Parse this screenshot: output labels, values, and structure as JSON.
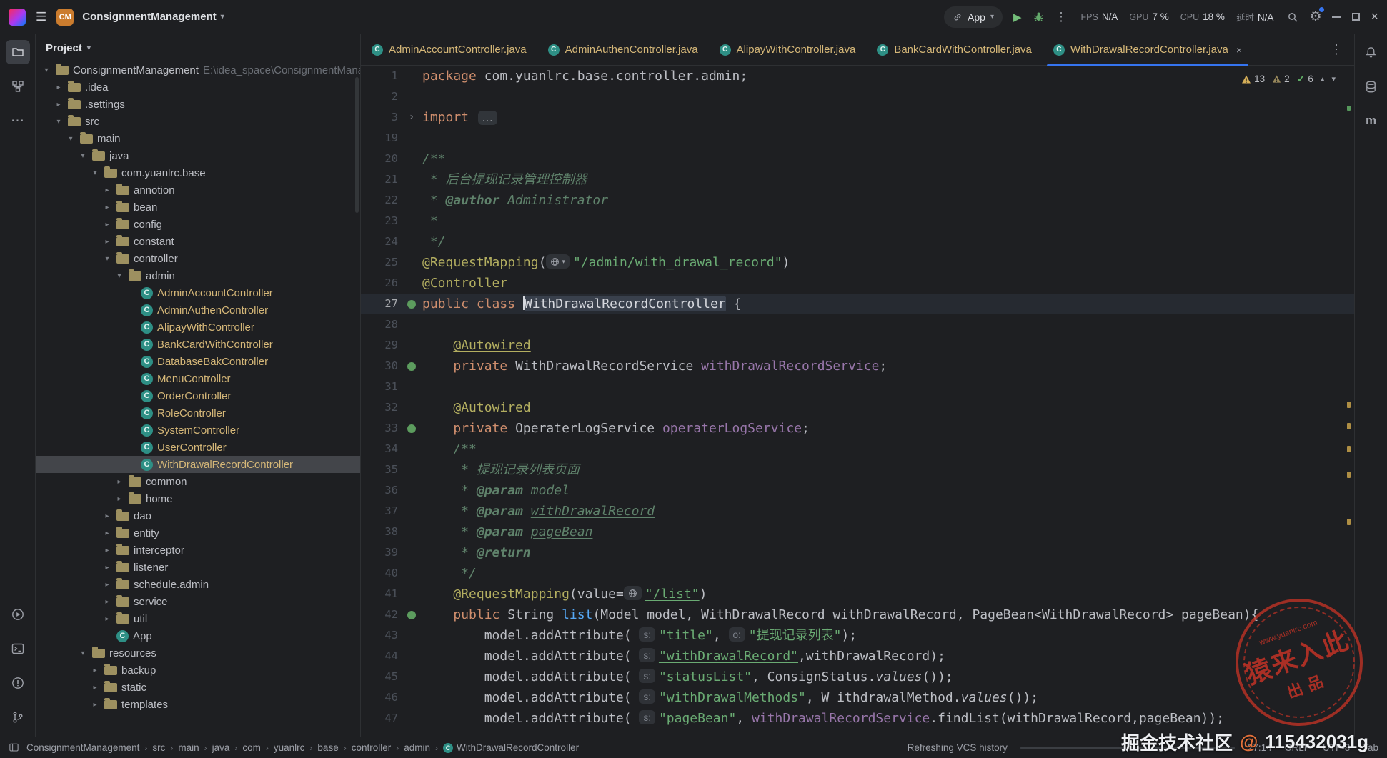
{
  "titlebar": {
    "project_name": "ConsignmentManagement",
    "badge": "CM",
    "run_config": "App",
    "stats": [
      {
        "label": "FPS",
        "value": "N/A"
      },
      {
        "label": "GPU",
        "value": "7 %"
      },
      {
        "label": "CPU",
        "value": "18 %"
      },
      {
        "label": "延时",
        "value": "N/A"
      }
    ]
  },
  "icons": {
    "hamburger-icon": "☰",
    "chevron-down-icon": "▾",
    "chevron-right-icon": "▸",
    "more-vertical-icon": "⋮",
    "more-horizontal-icon": "⋯",
    "run-icon": "▶",
    "close-icon": "×",
    "settings-gear-icon": "⚙",
    "check-icon": "✓",
    "maven-icon": "m",
    "prev-icon": "▴",
    "next-icon": "▾"
  },
  "project_tree": {
    "header": "Project",
    "items": [
      {
        "l": "ConsignmentManagement",
        "lv": 0,
        "ch": "o",
        "ic": "folder",
        "suffix": " E:\\idea_space\\ConsignmentManagemen"
      },
      {
        "l": ".idea",
        "lv": 1,
        "ch": "c",
        "ic": "folder"
      },
      {
        "l": ".settings",
        "lv": 1,
        "ch": "c",
        "ic": "folder"
      },
      {
        "l": "src",
        "lv": 1,
        "ch": "o",
        "ic": "folder"
      },
      {
        "l": "main",
        "lv": 2,
        "ch": "o",
        "ic": "folder"
      },
      {
        "l": "java",
        "lv": 3,
        "ch": "o",
        "ic": "folder"
      },
      {
        "l": "com.yuanlrc.base",
        "lv": 4,
        "ch": "o",
        "ic": "folder"
      },
      {
        "l": "annotion",
        "lv": 5,
        "ch": "c",
        "ic": "folder"
      },
      {
        "l": "bean",
        "lv": 5,
        "ch": "c",
        "ic": "folder"
      },
      {
        "l": "config",
        "lv": 5,
        "ch": "c",
        "ic": "folder"
      },
      {
        "l": "constant",
        "lv": 5,
        "ch": "c",
        "ic": "folder"
      },
      {
        "l": "controller",
        "lv": 5,
        "ch": "o",
        "ic": "folder"
      },
      {
        "l": "admin",
        "lv": 6,
        "ch": "o",
        "ic": "folder"
      },
      {
        "l": "AdminAccountController",
        "lv": 7,
        "ic": "class",
        "amber": true
      },
      {
        "l": "AdminAuthenController",
        "lv": 7,
        "ic": "class",
        "amber": true
      },
      {
        "l": "AlipayWithController",
        "lv": 7,
        "ic": "class",
        "amber": true
      },
      {
        "l": "BankCardWithController",
        "lv": 7,
        "ic": "class",
        "amber": true
      },
      {
        "l": "DatabaseBakController",
        "lv": 7,
        "ic": "class",
        "amber": true
      },
      {
        "l": "MenuController",
        "lv": 7,
        "ic": "class",
        "amber": true
      },
      {
        "l": "OrderController",
        "lv": 7,
        "ic": "class",
        "amber": true
      },
      {
        "l": "RoleController",
        "lv": 7,
        "ic": "class",
        "amber": true
      },
      {
        "l": "SystemController",
        "lv": 7,
        "ic": "class",
        "amber": true
      },
      {
        "l": "UserController",
        "lv": 7,
        "ic": "class",
        "amber": true
      },
      {
        "l": "WithDrawalRecordController",
        "lv": 7,
        "ic": "class",
        "amber": true,
        "sel": true
      },
      {
        "l": "common",
        "lv": 6,
        "ch": "c",
        "ic": "folder"
      },
      {
        "l": "home",
        "lv": 6,
        "ch": "c",
        "ic": "folder"
      },
      {
        "l": "dao",
        "lv": 5,
        "ch": "c",
        "ic": "folder"
      },
      {
        "l": "entity",
        "lv": 5,
        "ch": "c",
        "ic": "folder"
      },
      {
        "l": "interceptor",
        "lv": 5,
        "ch": "c",
        "ic": "folder"
      },
      {
        "l": "listener",
        "lv": 5,
        "ch": "c",
        "ic": "folder"
      },
      {
        "l": "schedule.admin",
        "lv": 5,
        "ch": "c",
        "ic": "folder"
      },
      {
        "l": "service",
        "lv": 5,
        "ch": "c",
        "ic": "folder"
      },
      {
        "l": "util",
        "lv": 5,
        "ch": "c",
        "ic": "folder"
      },
      {
        "l": "App",
        "lv": 5,
        "ic": "class"
      },
      {
        "l": "resources",
        "lv": 3,
        "ch": "o",
        "ic": "folder"
      },
      {
        "l": "backup",
        "lv": 4,
        "ch": "c",
        "ic": "folder"
      },
      {
        "l": "static",
        "lv": 4,
        "ch": "c",
        "ic": "folder"
      },
      {
        "l": "templates",
        "lv": 4,
        "ch": "c",
        "ic": "folder"
      }
    ]
  },
  "tabs": [
    {
      "label": "AdminAccountController.java"
    },
    {
      "label": "AdminAuthenController.java"
    },
    {
      "label": "AlipayWithController.java"
    },
    {
      "label": "BankCardWithController.java"
    },
    {
      "label": "WithDrawalRecordController.java",
      "active": true
    }
  ],
  "editor": {
    "inspections": {
      "warnings": "13",
      "weak_warnings": "2",
      "passed": "6"
    },
    "lines": [
      {
        "n": 1,
        "tk": [
          {
            "c": "k",
            "t": "package "
          },
          {
            "c": "d",
            "t": "com.yuanlrc.base.controller.admin;"
          }
        ]
      },
      {
        "n": 2,
        "tk": []
      },
      {
        "n": 3,
        "g": "fold",
        "tk": [
          {
            "c": "k",
            "t": "import "
          },
          {
            "c": "fold",
            "t": "..."
          }
        ]
      },
      {
        "n": 19,
        "tk": []
      },
      {
        "n": 20,
        "tk": [
          {
            "c": "c",
            "t": "/**"
          }
        ]
      },
      {
        "n": 21,
        "tk": [
          {
            "c": "c",
            "t": " * 后台提现记录管理控制器"
          }
        ]
      },
      {
        "n": 22,
        "tk": [
          {
            "c": "c",
            "t": " * "
          },
          {
            "c": "ct",
            "t": "@author"
          },
          {
            "c": "c",
            "t": " Administrator"
          }
        ]
      },
      {
        "n": 23,
        "tk": [
          {
            "c": "c",
            "t": " *"
          }
        ]
      },
      {
        "n": 24,
        "tk": [
          {
            "c": "c",
            "t": " */"
          }
        ]
      },
      {
        "n": 25,
        "tk": [
          {
            "c": "a",
            "t": "@RequestMapping"
          },
          {
            "c": "d",
            "t": "("
          },
          {
            "c": "globe",
            "dd": true
          },
          {
            "c": "su",
            "t": "\"/admin/with_drawal_record\""
          },
          {
            "c": "d",
            "t": ")"
          }
        ]
      },
      {
        "n": 26,
        "tk": [
          {
            "c": "a",
            "t": "@Controller"
          }
        ]
      },
      {
        "n": 27,
        "active": true,
        "g": "spring",
        "tk": [
          {
            "c": "k",
            "t": "public class "
          },
          {
            "c": "caret"
          },
          {
            "c": "dh",
            "t": "WithDrawalRecordController"
          },
          {
            "c": "d",
            "t": " {"
          }
        ]
      },
      {
        "n": 28,
        "tk": []
      },
      {
        "n": 29,
        "tk": [
          {
            "c": "d",
            "t": "    "
          },
          {
            "c": "au",
            "t": "@Autowired"
          }
        ]
      },
      {
        "n": 30,
        "g": "spring",
        "tk": [
          {
            "c": "d",
            "t": "    "
          },
          {
            "c": "k",
            "t": "private "
          },
          {
            "c": "d",
            "t": "WithDrawalRecordService "
          },
          {
            "c": "f",
            "t": "withDrawalRecordService"
          },
          {
            "c": "d",
            "t": ";"
          }
        ]
      },
      {
        "n": 31,
        "tk": []
      },
      {
        "n": 32,
        "tk": [
          {
            "c": "d",
            "t": "    "
          },
          {
            "c": "au",
            "t": "@Autowired"
          }
        ]
      },
      {
        "n": 33,
        "g": "spring",
        "tk": [
          {
            "c": "d",
            "t": "    "
          },
          {
            "c": "k",
            "t": "private "
          },
          {
            "c": "d",
            "t": "OperaterLogService "
          },
          {
            "c": "f",
            "t": "operaterLogService"
          },
          {
            "c": "d",
            "t": ";"
          }
        ]
      },
      {
        "n": 34,
        "tk": [
          {
            "c": "d",
            "t": "    "
          },
          {
            "c": "c",
            "t": "/**"
          }
        ]
      },
      {
        "n": 35,
        "tk": [
          {
            "c": "d",
            "t": "    "
          },
          {
            "c": "c",
            "t": " * 提现记录列表页面"
          }
        ]
      },
      {
        "n": 36,
        "tk": [
          {
            "c": "d",
            "t": "    "
          },
          {
            "c": "c",
            "t": " * "
          },
          {
            "c": "ct",
            "t": "@param"
          },
          {
            "c": "c",
            "t": " "
          },
          {
            "c": "cp",
            "t": "model"
          }
        ]
      },
      {
        "n": 37,
        "tk": [
          {
            "c": "d",
            "t": "    "
          },
          {
            "c": "c",
            "t": " * "
          },
          {
            "c": "ct",
            "t": "@param"
          },
          {
            "c": "c",
            "t": " "
          },
          {
            "c": "cp",
            "t": "withDrawalRecord"
          }
        ]
      },
      {
        "n": 38,
        "tk": [
          {
            "c": "d",
            "t": "    "
          },
          {
            "c": "c",
            "t": " * "
          },
          {
            "c": "ct",
            "t": "@param"
          },
          {
            "c": "c",
            "t": " "
          },
          {
            "c": "cp",
            "t": "pageBean"
          }
        ]
      },
      {
        "n": 39,
        "tk": [
          {
            "c": "d",
            "t": "    "
          },
          {
            "c": "c",
            "t": " * "
          },
          {
            "c": "ctu",
            "t": "@return"
          }
        ]
      },
      {
        "n": 40,
        "tk": [
          {
            "c": "d",
            "t": "    "
          },
          {
            "c": "c",
            "t": " */"
          }
        ]
      },
      {
        "n": 41,
        "tk": [
          {
            "c": "d",
            "t": "    "
          },
          {
            "c": "a",
            "t": "@RequestMapping"
          },
          {
            "c": "d",
            "t": "(value="
          },
          {
            "c": "globe"
          },
          {
            "c": "su",
            "t": "\"/list\""
          },
          {
            "c": "d",
            "t": ")"
          }
        ]
      },
      {
        "n": 42,
        "g": "spring",
        "tk": [
          {
            "c": "d",
            "t": "    "
          },
          {
            "c": "k",
            "t": "public "
          },
          {
            "c": "d",
            "t": "String "
          },
          {
            "c": "m",
            "t": "list"
          },
          {
            "c": "d",
            "t": "(Model model, WithDrawalRecord withDrawalRecord, PageBean<WithDrawalRecord> pageBean){"
          }
        ]
      },
      {
        "n": 43,
        "tk": [
          {
            "c": "d",
            "t": "        model.addAttribute( "
          },
          {
            "c": "hint",
            "t": "s:"
          },
          {
            "c": "s",
            "t": "\"title\""
          },
          {
            "c": "d",
            "t": ", "
          },
          {
            "c": "hint",
            "t": "o:"
          },
          {
            "c": "s",
            "t": "\"提现记录列表\""
          },
          {
            "c": "d",
            "t": ");"
          }
        ]
      },
      {
        "n": 44,
        "tk": [
          {
            "c": "d",
            "t": "        model.addAttribute( "
          },
          {
            "c": "hint",
            "t": "s:"
          },
          {
            "c": "su",
            "t": "\"withDrawalRecord\""
          },
          {
            "c": "d",
            "t": ",withDrawalRecord);"
          }
        ]
      },
      {
        "n": 45,
        "tk": [
          {
            "c": "d",
            "t": "        model.addAttribute( "
          },
          {
            "c": "hint",
            "t": "s:"
          },
          {
            "c": "s",
            "t": "\"statusList\""
          },
          {
            "c": "d",
            "t": ", ConsignStatus."
          },
          {
            "c": "st",
            "t": "values"
          },
          {
            "c": "d",
            "t": "());"
          }
        ]
      },
      {
        "n": 46,
        "tk": [
          {
            "c": "d",
            "t": "        model.addAttribute( "
          },
          {
            "c": "hint",
            "t": "s:"
          },
          {
            "c": "s",
            "t": "\"withDrawalMethods\""
          },
          {
            "c": "d",
            "t": ", W ithdrawalMethod."
          },
          {
            "c": "st",
            "t": "values"
          },
          {
            "c": "d",
            "t": "());"
          }
        ]
      },
      {
        "n": 47,
        "tk": [
          {
            "c": "d",
            "t": "        model.addAttribute( "
          },
          {
            "c": "hint",
            "t": "s:"
          },
          {
            "c": "s",
            "t": "\"pageBean\""
          },
          {
            "c": "d",
            "t": ", "
          },
          {
            "c": "f",
            "t": "withDrawalRecordService"
          },
          {
            "c": "d",
            "t": ".findList(withDrawalRecord,pageBean));"
          }
        ]
      }
    ]
  },
  "statusbar": {
    "breadcrumb": [
      "ConsignmentManagement",
      "src",
      "main",
      "java",
      "com",
      "yuanlrc",
      "base",
      "controller",
      "admin",
      "WithDrawalRecordController"
    ],
    "vcs_status": "Refreshing VCS history",
    "progress_percent": 55,
    "caret_position": "27:14",
    "line_separator": "CRLF",
    "encoding": "UTF-8",
    "indent": "Tab"
  },
  "watermark": {
    "stamp_site": "www.yuanlrc.com",
    "stamp_main": "猿来入此",
    "stamp_sub": "出品",
    "credit_prefix": "掘金技术社区",
    "credit_at": "@",
    "credit_suffix": "115432031g"
  }
}
